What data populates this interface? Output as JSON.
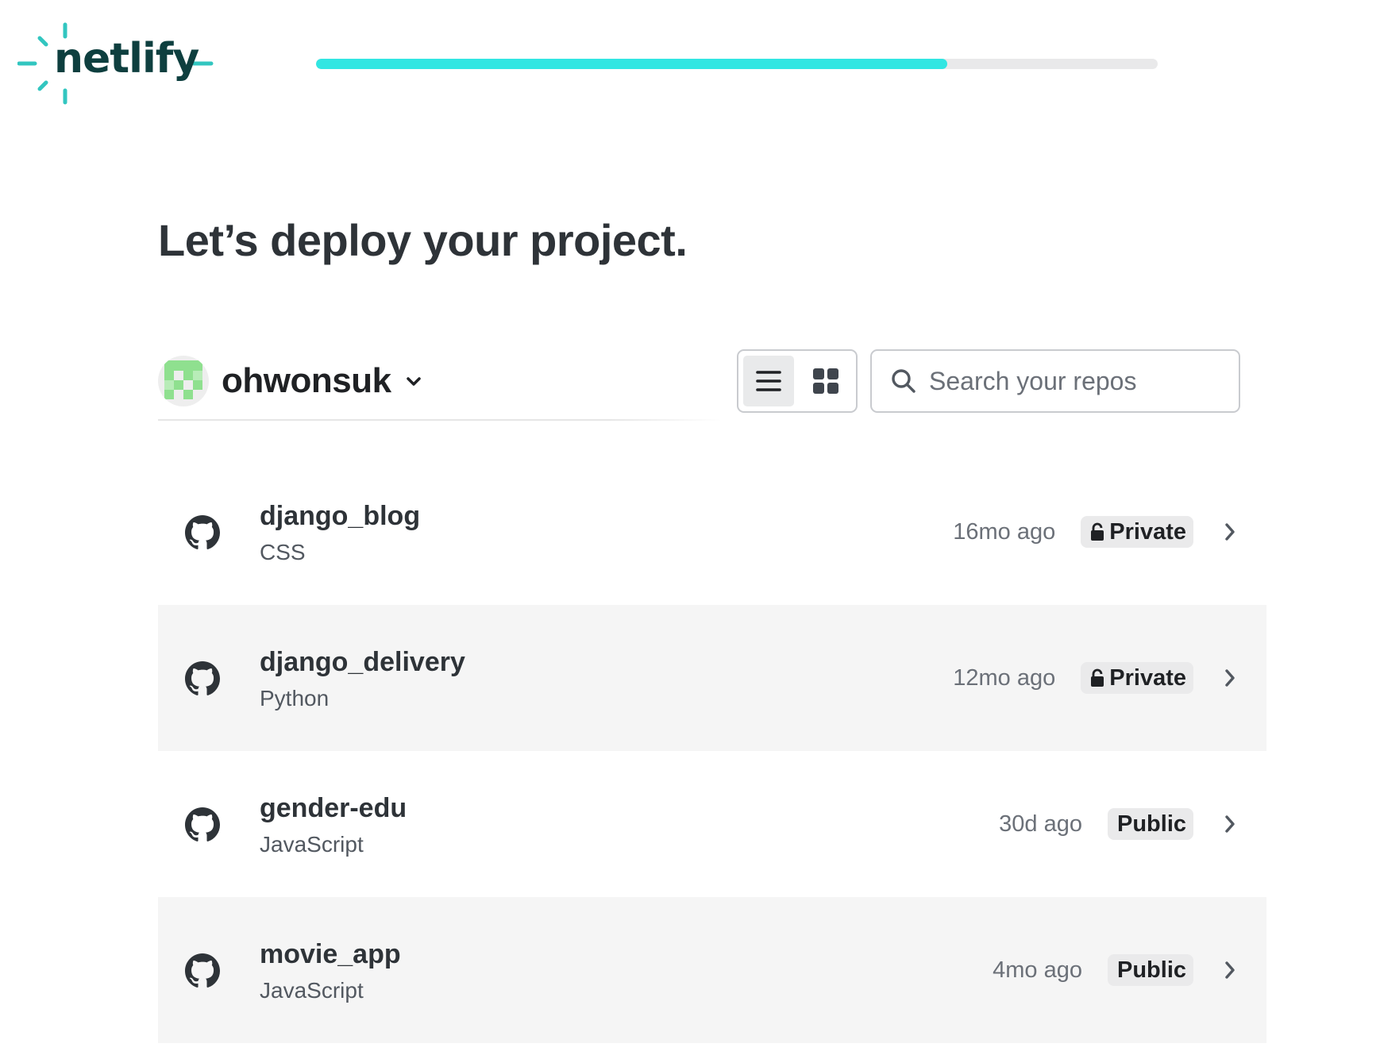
{
  "brand": {
    "logo_text": "netlify",
    "accent": "#32e6e2",
    "dark": "#0e3f3f"
  },
  "progress": {
    "fraction": 0.75
  },
  "heading": {
    "title": "Let’s deploy your project."
  },
  "account": {
    "name": "ohwonsuk",
    "avatar_icon": "avatar-identicon",
    "chevron_icon": "chevron-down-icon"
  },
  "view_toggle": {
    "list_icon": "list-icon",
    "grid_icon": "grid-icon",
    "active": "list"
  },
  "search": {
    "placeholder": "Search your repos",
    "value": "",
    "icon": "search-icon"
  },
  "repos": [
    {
      "name": "django_blog",
      "language": "CSS",
      "updated": "16mo ago",
      "visibility": "Private",
      "locked": true,
      "highlighted": false
    },
    {
      "name": "django_delivery",
      "language": "Python",
      "updated": "12mo ago",
      "visibility": "Private",
      "locked": true,
      "highlighted": true
    },
    {
      "name": "gender-edu",
      "language": "JavaScript",
      "updated": "30d ago",
      "visibility": "Public",
      "locked": false,
      "highlighted": false
    },
    {
      "name": "movie_app",
      "language": "JavaScript",
      "updated": "4mo ago",
      "visibility": "Public",
      "locked": false,
      "highlighted": true
    }
  ]
}
